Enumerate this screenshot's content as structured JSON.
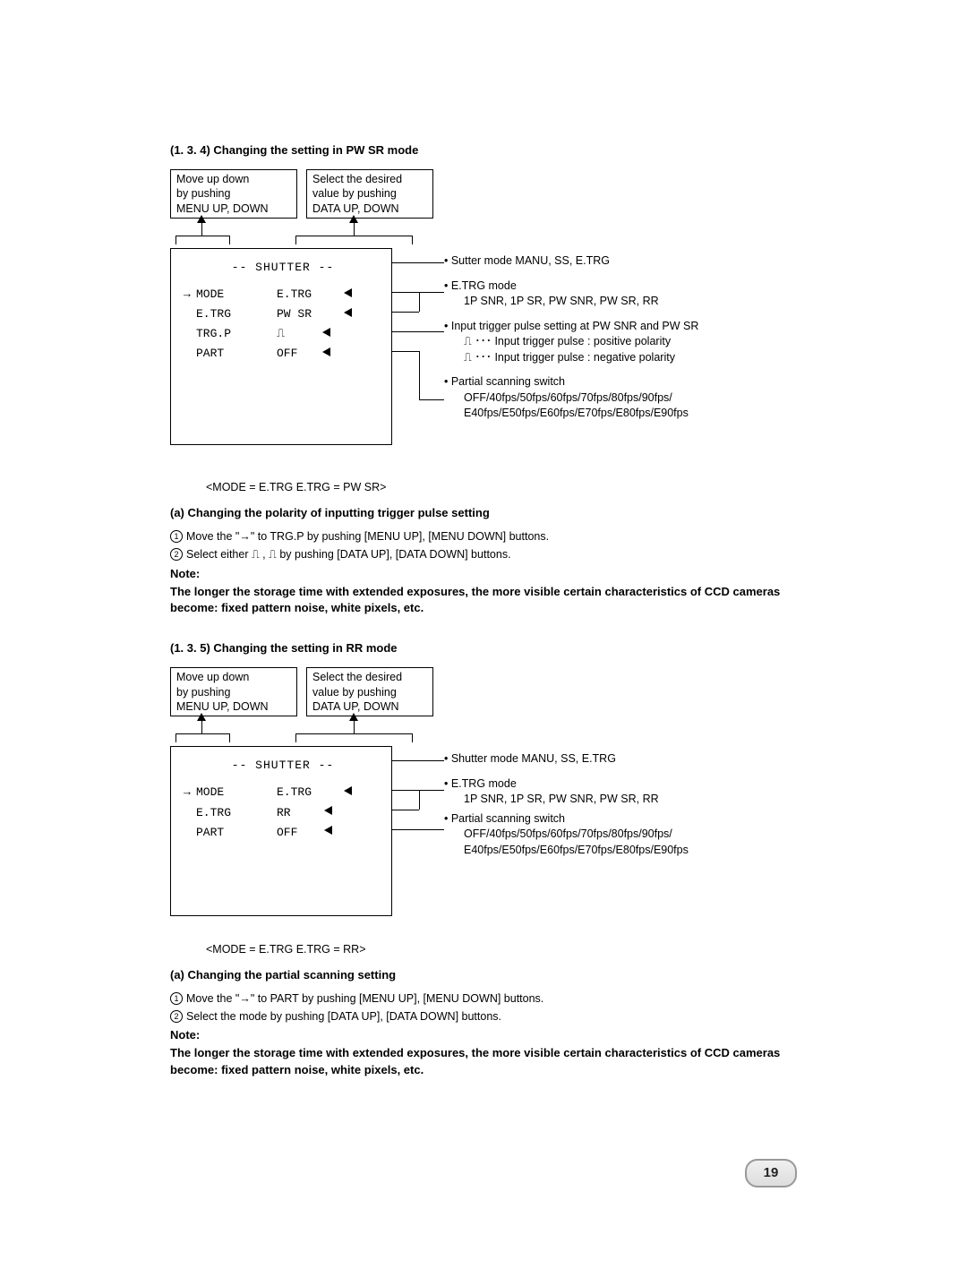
{
  "section134": {
    "heading": "(1. 3. 4)   Changing the setting in PW SR mode",
    "box_left_l1": "Move up down",
    "box_left_l2": "by pushing",
    "box_left_l3": "MENU UP, DOWN",
    "box_right_l1": "Select the desired",
    "box_right_l2": "value by pushing",
    "box_right_l3": "DATA UP, DOWN",
    "screen_title": "-- SHUTTER --",
    "row_mode_label": "MODE",
    "row_mode_val": "E.TRG",
    "row_etrg_label": "E.TRG",
    "row_etrg_val": "PW SR",
    "row_trgp_label": "TRG.P",
    "row_trgp_val": "⎍",
    "row_part_label": "PART",
    "row_part_val": "OFF",
    "ann_shutter": "• Sutter mode   MANU, SS, E.TRG",
    "ann_etrg_head": "• E.TRG mode",
    "ann_etrg_sub": "1P SNR, 1P SR, PW SNR, PW SR, RR",
    "ann_trgp_head": "• Input trigger pulse setting at PW SNR and PW SR",
    "ann_trgp_pos": "⎍  ･･･ Input trigger pulse : positive polarity",
    "ann_trgp_neg": "⎍  ･･･ Input trigger pulse : negative polarity",
    "ann_part_head": "• Partial scanning switch",
    "ann_part_l1": "OFF/40fps/50fps/60fps/70fps/80fps/90fps/",
    "ann_part_l2": "E40fps/E50fps/E60fps/E70fps/E80fps/E90fps",
    "caption": "<MODE = E.TRG   E.TRG = PW SR>",
    "sub_a": "(a)   Changing the polarity of inputting trigger pulse setting",
    "step1": "Move the \"→\" to TRG.P by pushing [MENU UP], [MENU DOWN] buttons.",
    "step2": "Select either ⎍ , ⎍ by pushing [DATA UP], [DATA DOWN] buttons.",
    "note_label": "Note:",
    "note_text": "The longer the storage time with extended exposures, the more visible certain characteristics of CCD cameras become: fixed pattern noise, white pixels, etc."
  },
  "section135": {
    "heading": "(1. 3. 5)   Changing the setting in RR mode",
    "box_left_l1": "Move up down",
    "box_left_l2": "by pushing",
    "box_left_l3": "MENU UP, DOWN",
    "box_right_l1": "Select the desired",
    "box_right_l2": "value by pushing",
    "box_right_l3": "DATA UP, DOWN",
    "screen_title": "-- SHUTTER --",
    "row_mode_label": "MODE",
    "row_mode_val": "E.TRG",
    "row_etrg_label": "E.TRG",
    "row_etrg_val": "RR",
    "row_part_label": "PART",
    "row_part_val": "OFF",
    "ann_shutter": "• Shutter mode   MANU, SS, E.TRG",
    "ann_etrg_head": "• E.TRG mode",
    "ann_etrg_sub": "1P SNR, 1P SR, PW SNR, PW SR, RR",
    "ann_part_head": "• Partial scanning switch",
    "ann_part_l1": "OFF/40fps/50fps/60fps/70fps/80fps/90fps/",
    "ann_part_l2": "E40fps/E50fps/E60fps/E70fps/E80fps/E90fps",
    "caption": "<MODE = E.TRG   E.TRG = RR>",
    "sub_a": "(a)   Changing the partial scanning setting",
    "step1": "Move the \"→\" to PART by pushing [MENU UP], [MENU DOWN] buttons.",
    "step2": "Select the mode by pushing [DATA UP], [DATA DOWN] buttons.",
    "note_label": "Note:",
    "note_text": "The longer the storage time with extended exposures, the more visible certain characteristics of CCD cameras become: fixed pattern noise, white pixels, etc."
  },
  "page_number": "19"
}
